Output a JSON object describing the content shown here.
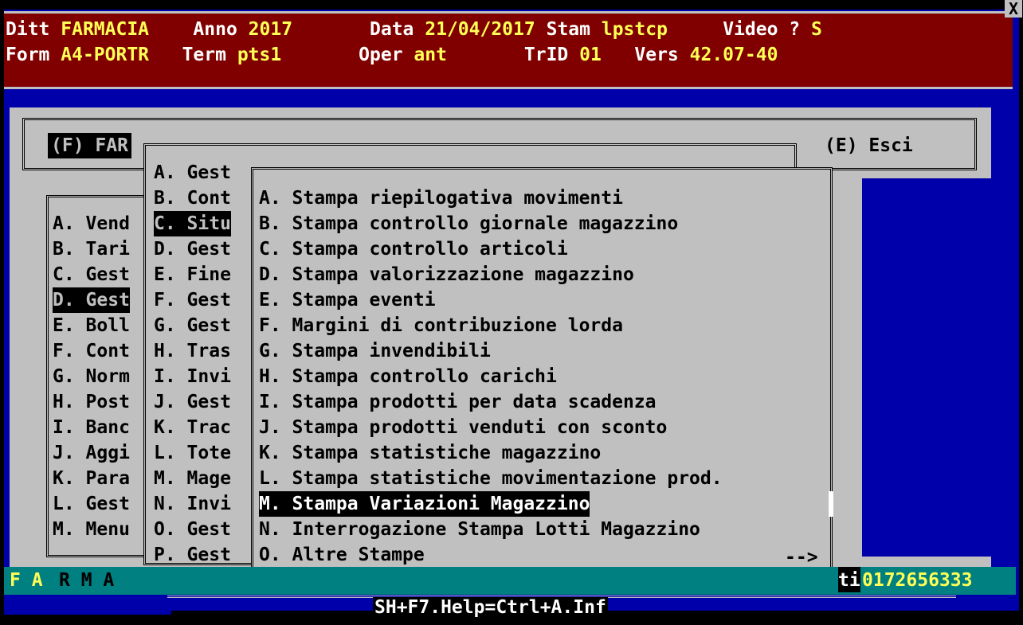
{
  "header": {
    "row1": {
      "ditt_label": "Ditt",
      "ditt_value": "FARMACIA",
      "anno_label": "Anno",
      "anno_value": "2017",
      "data_label": "Data",
      "data_value": "21/04/2017",
      "stam_label": "Stam",
      "stam_value": "lpstcp",
      "video_label": "Video ?",
      "video_value": "S"
    },
    "row2": {
      "form_label": "Form",
      "form_value": "A4-PORTR",
      "term_label": "Term",
      "term_value": "pts1",
      "oper_label": "Oper",
      "oper_value": "ant",
      "trid_label": "TrID",
      "trid_value": "01",
      "vers_label": "Vers",
      "vers_value": "42.07-40"
    }
  },
  "close_label": "X",
  "top_panel": {
    "title": "(F) FAR",
    "exit": "(E) Esci"
  },
  "left_menu": [
    "A. Vend",
    "B. Tari",
    "C. Gest",
    "D. Gest",
    "E. Boll",
    "F. Cont",
    "G. Norm",
    "H. Post",
    "I. Banc",
    "J. Aggi",
    "K. Para",
    "L. Gest",
    "M. Menu"
  ],
  "left_selected_index": 3,
  "mid_menu": [
    "A. Gest",
    "B. Cont",
    "C. Situ",
    "D. Gest",
    "E. Fine",
    "F. Gest",
    "G. Gest",
    "H. Tras",
    "I. Invi",
    "J. Gest",
    "K. Trac",
    "L. Tote",
    "M. Mage",
    "N. Invi",
    "O. Gest",
    "P. Gest"
  ],
  "mid_selected_index": 2,
  "right_menu": [
    "A. Stampa riepilogativa movimenti",
    "B. Stampa controllo giornale magazzino",
    "C. Stampa controllo articoli",
    "D. Stampa valorizzazione magazzino",
    "E. Stampa eventi",
    "F. Margini di contribuzione lorda",
    "G. Stampa invendibili",
    "H. Stampa controllo carichi",
    "I. Stampa prodotti per data scadenza",
    "J. Stampa prodotti venduti con sconto",
    "K. Stampa statistiche magazzino",
    "L. Stampa statistiche movimentazione prod.",
    "M. Stampa Variazioni Magazzino",
    "N. Interrogazione Stampa Lotti Magazzino",
    "O. Altre Stampe"
  ],
  "right_selected_index": 12,
  "more_arrow": "-->",
  "status_bar": {
    "farm": "F A",
    "farm_rest": "R M A",
    "ti": "ti",
    "phone": "0172656333"
  },
  "help_bar": "SH+F7.Help=Ctrl+A.Inf"
}
